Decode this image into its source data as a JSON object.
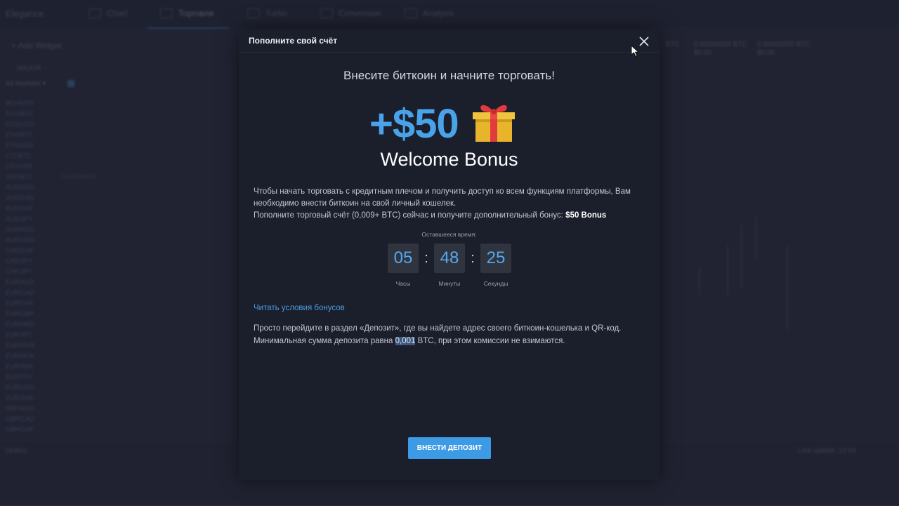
{
  "background": {
    "brand": "Elegance",
    "nav_tabs": [
      "Chart",
      "Торговля",
      "Turbo",
      "Conversion",
      "Analysis"
    ],
    "add_widget": "Add Widget",
    "list_tabs": "MAJOR   ···",
    "markets_filter": "All Markets ▾",
    "markets": [
      {
        "pair": "BCH/USD",
        "value": ""
      },
      {
        "pair": "EOS/BTC",
        "value": ""
      },
      {
        "pair": "EOS/USD",
        "value": ""
      },
      {
        "pair": "ETH/BTC",
        "value": ""
      },
      {
        "pair": "ETH/USD",
        "value": ""
      },
      {
        "pair": "LTC/BTC",
        "value": ""
      },
      {
        "pair": "LTC/USD",
        "value": ""
      },
      {
        "pair": "XRP/BTC",
        "value": "0.00003530"
      },
      {
        "pair": "AUD/USD",
        "value": ""
      },
      {
        "pair": "AUD/CAD",
        "value": ""
      },
      {
        "pair": "AUD/CHF",
        "value": ""
      },
      {
        "pair": "AUD/JPY",
        "value": ""
      },
      {
        "pair": "AUD/NZD",
        "value": ""
      },
      {
        "pair": "AUD/USD",
        "value": ""
      },
      {
        "pair": "CAD/CHF",
        "value": ""
      },
      {
        "pair": "CAD/JPY",
        "value": ""
      },
      {
        "pair": "CHF/JPY",
        "value": ""
      },
      {
        "pair": "EUR/AUD",
        "value": ""
      },
      {
        "pair": "EUR/CAD",
        "value": ""
      },
      {
        "pair": "EUR/CHF",
        "value": ""
      },
      {
        "pair": "EUR/GBP",
        "value": ""
      },
      {
        "pair": "EUR/HKD",
        "value": ""
      },
      {
        "pair": "EUR/JPY",
        "value": ""
      },
      {
        "pair": "EUR/MXN",
        "value": ""
      },
      {
        "pair": "EUR/NOK",
        "value": ""
      },
      {
        "pair": "EUR/SEK",
        "value": ""
      },
      {
        "pair": "EUR/TRY",
        "value": ""
      },
      {
        "pair": "EUR/USD",
        "value": ""
      },
      {
        "pair": "EUR/ZAR",
        "value": ""
      },
      {
        "pair": "GBP/AUD",
        "value": ""
      },
      {
        "pair": "GBP/CAD",
        "value": ""
      },
      {
        "pair": "GBP/CHF",
        "value": ""
      }
    ],
    "balance_0": "BTC",
    "balance_1": "0.00000000 BTC",
    "balance_1_sub": "$0.00",
    "balance_2": "0.00000000 BTC",
    "balance_2_sub": "$0.00",
    "bottom_left": "Orders",
    "bottom_right": "Last update: 12:04"
  },
  "modal": {
    "title": "Пополните свой счёт",
    "subtitle": "Внесите биткоин и начните торговать!",
    "bonus_amount": "+$50",
    "bonus_label": "Welcome Bonus",
    "desc_line1": "Чтобы начать торговать с кредитным плечом и получить доступ ко всем функциям платформы, Вам необходимо внести биткоин на свой личный кошелек.",
    "desc_line2_prefix": "Пополните торговый счёт (0,009+ BTC) сейчас и получите дополнительный бонус:",
    "desc_line2_bold": "$50 Bonus",
    "timer_label": "Оставшееся время:",
    "timer": {
      "hours": "05",
      "minutes": "48",
      "seconds": "25",
      "hours_label": "Часы",
      "minutes_label": "Минуты",
      "seconds_label": "Секунды",
      "separator": ":"
    },
    "terms_link": "Читать условия бонусов",
    "info_line1": "Просто перейдите в раздел «Депозит», где вы найдете адрес своего биткоин-кошелька и QR-код.",
    "info_line2_prefix": "Минимальная сумма депозита равна",
    "info_line2_highlight": "0,001",
    "info_line2_suffix": "BTC, при этом комиссии не взимаются.",
    "deposit_button": "ВНЕСТИ ДЕПОЗИТ",
    "colors": {
      "accent": "#3d9be6",
      "bonus": "#49a3ea",
      "modal_bg": "#1b1e2b",
      "timer_box": "#30343f"
    }
  }
}
